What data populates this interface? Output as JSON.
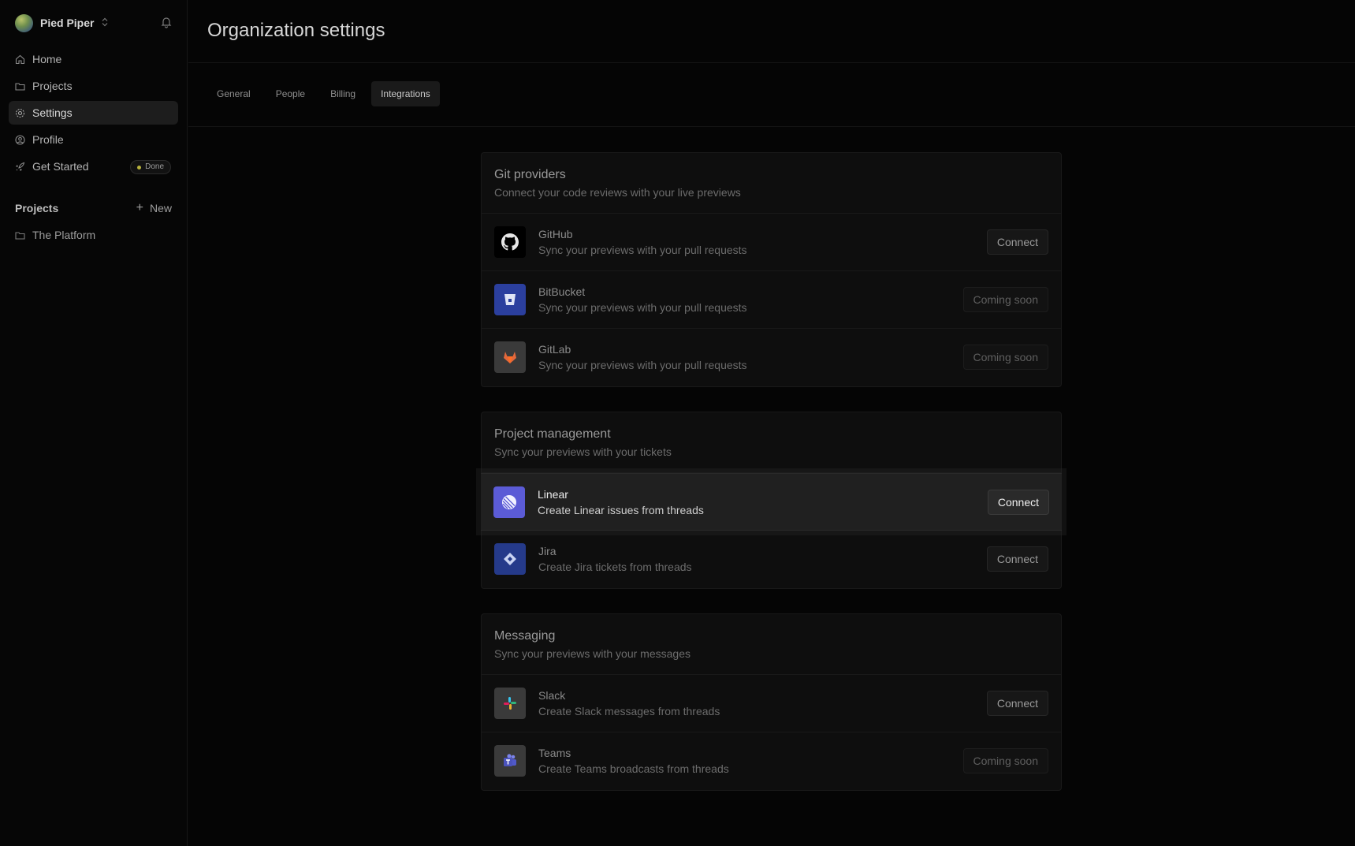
{
  "sidebar": {
    "org_name": "Pied Piper",
    "nav": [
      {
        "label": "Home",
        "icon": "home-icon"
      },
      {
        "label": "Projects",
        "icon": "folder-icon"
      },
      {
        "label": "Settings",
        "icon": "gear-icon",
        "active": true
      },
      {
        "label": "Profile",
        "icon": "user-circle-icon"
      },
      {
        "label": "Get Started",
        "icon": "rocket-icon",
        "badge": "Done"
      }
    ],
    "projects_heading": "Projects",
    "new_label": "New",
    "projects": [
      {
        "label": "The Platform",
        "icon": "folder-icon"
      }
    ]
  },
  "main": {
    "title": "Organization settings",
    "tabs": [
      {
        "label": "General"
      },
      {
        "label": "People"
      },
      {
        "label": "Billing"
      },
      {
        "label": "Integrations",
        "active": true
      }
    ],
    "sections": [
      {
        "title": "Git providers",
        "subtitle": "Connect your code reviews with your live previews",
        "items": [
          {
            "name": "GitHub",
            "desc": "Sync your previews with your pull requests",
            "action": "Connect",
            "icon": "github-icon"
          },
          {
            "name": "BitBucket",
            "desc": "Sync your previews with your pull requests",
            "action": "Coming soon",
            "icon": "bitbucket-icon"
          },
          {
            "name": "GitLab",
            "desc": "Sync your previews with your pull requests",
            "action": "Coming soon",
            "icon": "gitlab-icon"
          }
        ]
      },
      {
        "title": "Project management",
        "subtitle": "Sync your previews with your tickets",
        "items": [
          {
            "name": "Linear",
            "desc": "Create Linear issues from threads",
            "action": "Connect",
            "icon": "linear-icon",
            "highlighted": true
          },
          {
            "name": "Jira",
            "desc": "Create Jira tickets from threads",
            "action": "Connect",
            "icon": "jira-icon"
          }
        ]
      },
      {
        "title": "Messaging",
        "subtitle": "Sync your previews with your messages",
        "items": [
          {
            "name": "Slack",
            "desc": "Create Slack messages from threads",
            "action": "Connect",
            "icon": "slack-icon"
          },
          {
            "name": "Teams",
            "desc": "Create Teams broadcasts from threads",
            "action": "Coming soon",
            "icon": "teams-icon"
          }
        ]
      }
    ]
  },
  "colors": {
    "background": "#050505",
    "card": "#0e0e0e",
    "badge_dot": "#b7b23c",
    "bitbucket": "#2b3f9e",
    "linear": "#5b5bd6",
    "jira": "#253a8a"
  }
}
